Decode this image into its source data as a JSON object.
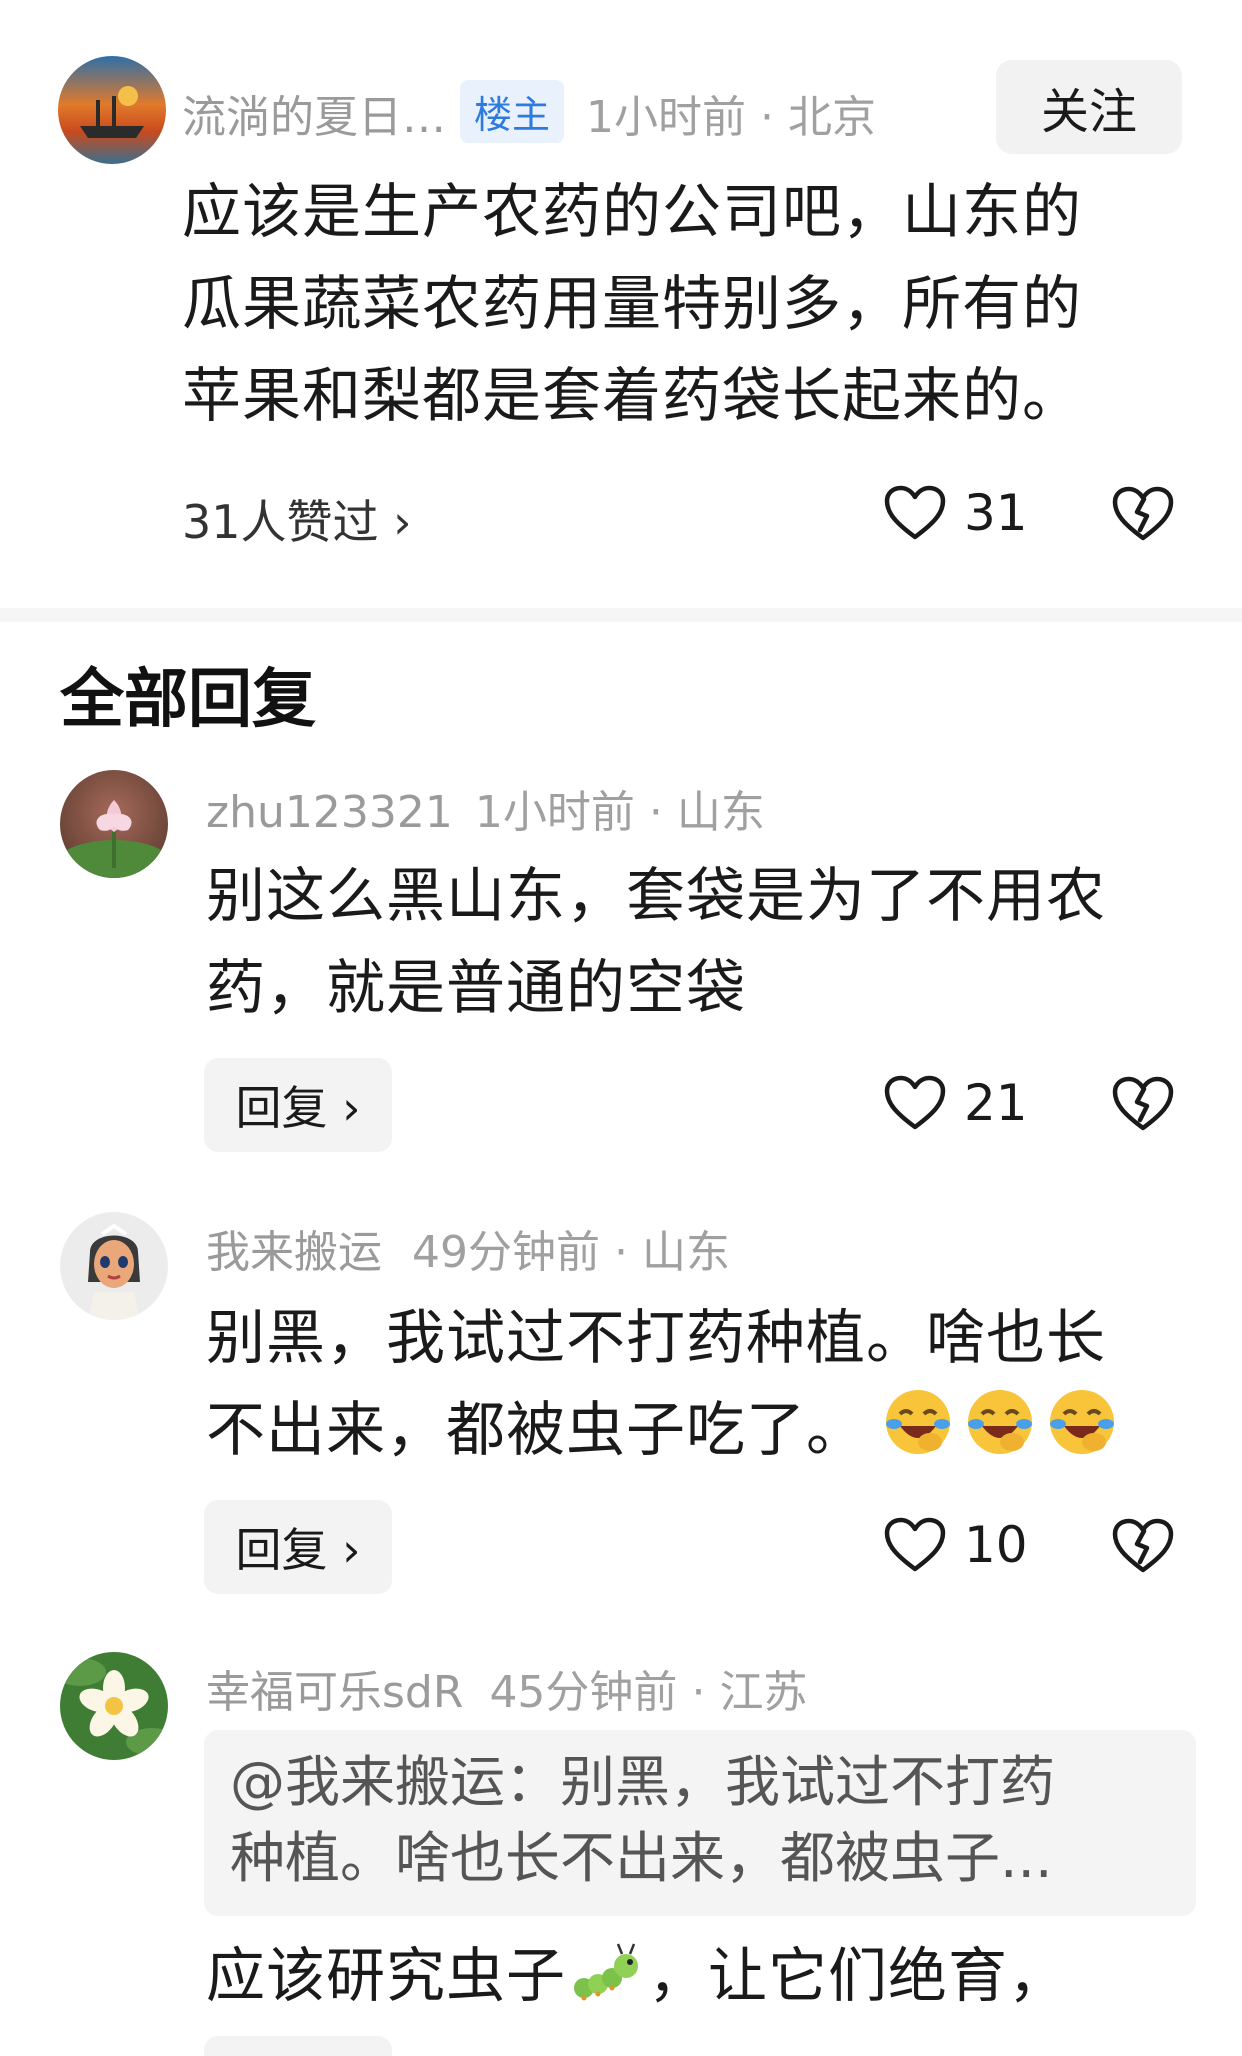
{
  "post": {
    "author": "流淌的夏日…",
    "badge": "楼主",
    "time": "1小时前",
    "location": "北京",
    "follow_label": "关注",
    "lines": [
      "应该是生产农药的公司吧，山东的",
      "瓜果蔬菜农药用量特别多，所有的",
      "苹果和梨都是套着药袋长起来的。"
    ],
    "likes_summary": "31人赞过 ›",
    "like_count": "31"
  },
  "section_title": "全部回复",
  "replies": [
    {
      "author": "zhu123321",
      "time": "1小时前",
      "location": "山东",
      "lines": [
        "别这么黑山东，套袋是为了不用农",
        "药，就是普通的空袋"
      ],
      "reply_label": "回复 ›",
      "like_count": "21"
    },
    {
      "author": "我来搬运",
      "time": "49分钟前",
      "location": "山东",
      "lines": [
        "别黑，我试过不打药种植。啥也长",
        "不出来，都被虫子吃了。"
      ],
      "reply_label": "回复 ›",
      "like_count": "10"
    },
    {
      "author": "幸福可乐sdR",
      "time": "45分钟前",
      "location": "江苏",
      "quote_lines": [
        "@我来搬运：别黑，我试过不打药",
        "种植。啥也长不出来，都被虫子..."
      ],
      "text_before_emoji": "应该研究虫子",
      "text_after_emoji": "，让它们绝育，"
    }
  ],
  "icons": {
    "like": "heart-outline-icon",
    "dislike": "broken-heart-icon",
    "laugh_cry": "rolling-laughing-emoji",
    "caterpillar": "caterpillar-emoji"
  },
  "colors": {
    "badge_bg": "#e8f1fc",
    "badge_text": "#2e7be0",
    "meta_text": "#a0a0a0"
  }
}
